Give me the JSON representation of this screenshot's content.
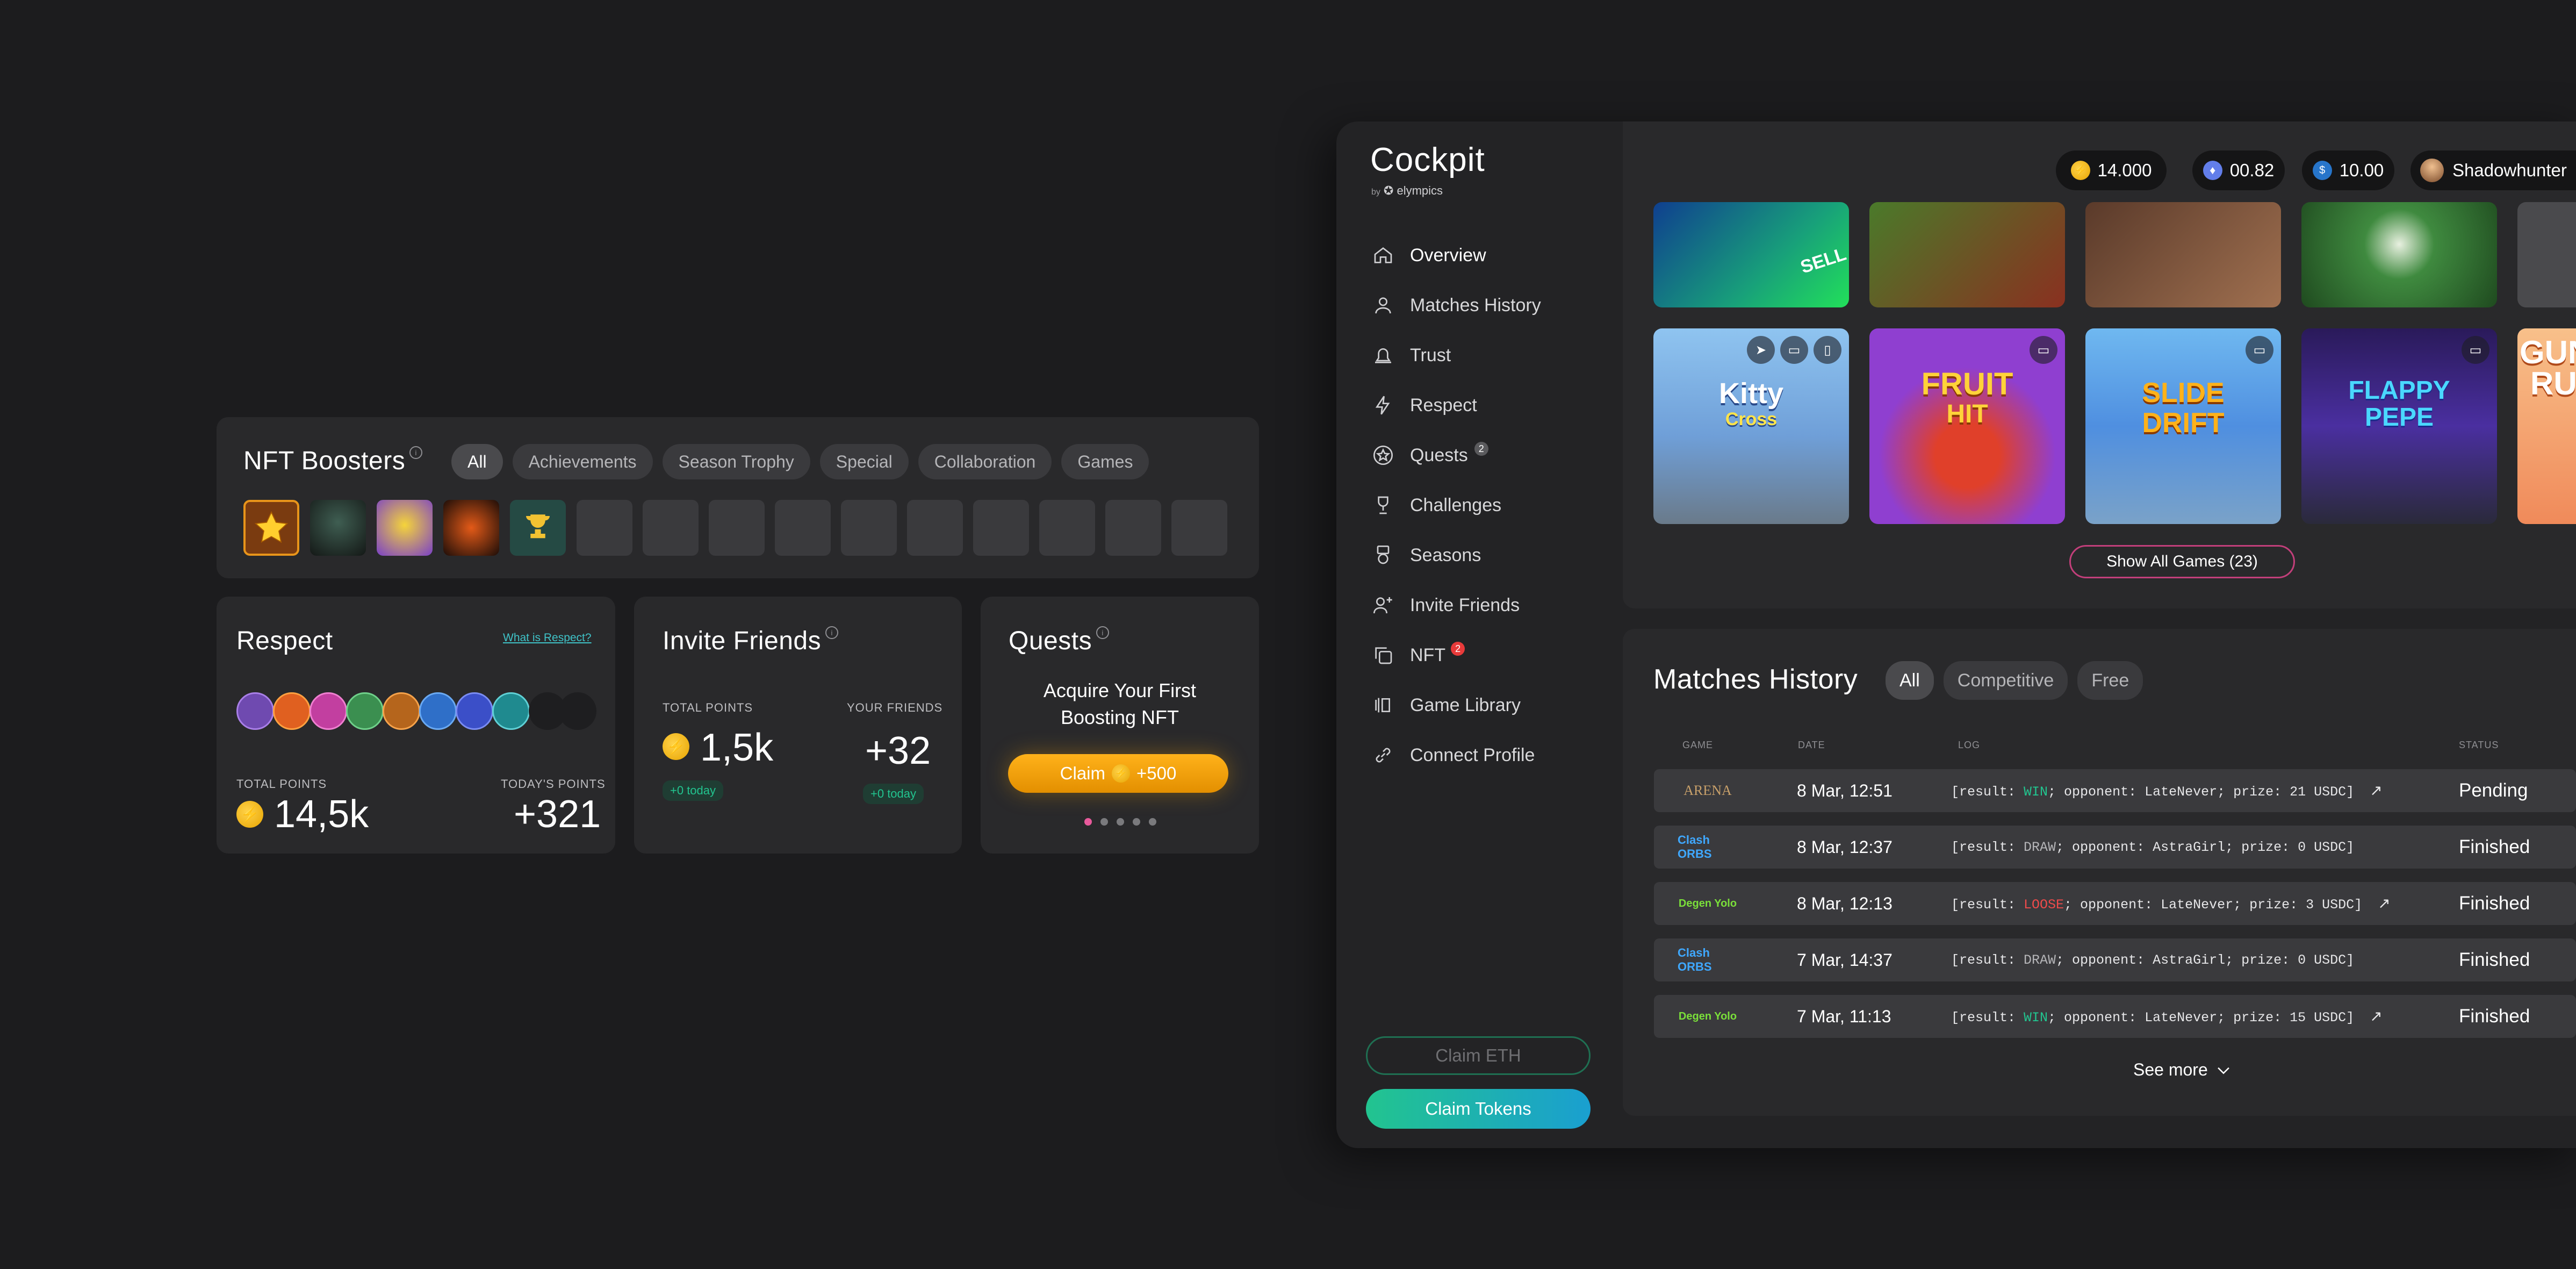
{
  "nft_boosters": {
    "title": "NFT Boosters",
    "filters": [
      "All",
      "Achievements",
      "Season Trophy",
      "Special",
      "Collaboration",
      "Games"
    ]
  },
  "respect": {
    "title": "Respect",
    "link": "What is Respect?",
    "total_label": "TOTAL POINTS",
    "total_value": "14,5k",
    "today_label": "TODAY'S POINTS",
    "today_value": "+321"
  },
  "invite": {
    "title": "Invite Friends",
    "total_label": "TOTAL POINTS",
    "total_value": "1,5k",
    "total_today": "+0 today",
    "friends_label": "YOUR FRIENDS",
    "friends_value": "+32",
    "friends_today": "+0 today"
  },
  "quests": {
    "title": "Quests",
    "text_line1": "Acquire Your First",
    "text_line2": "Boosting NFT",
    "claim_label": "Claim",
    "claim_amount": "+500"
  },
  "app": {
    "title": "Cockpit",
    "by": "by",
    "brand": "elympics"
  },
  "wallet": {
    "coins": "14.000",
    "eth": "00.82",
    "usdc": "10.00",
    "username": "Shadowhunter"
  },
  "nav": {
    "overview": "Overview",
    "matches": "Matches History",
    "trust": "Trust",
    "respect": "Respect",
    "quests": "Quests",
    "quests_badge": "2",
    "challenges": "Challenges",
    "seasons": "Seasons",
    "invite": "Invite Friends",
    "nft": "NFT",
    "nft_badge": "2",
    "library": "Game Library",
    "connect": "Connect Profile"
  },
  "games": {
    "tiles": [
      {
        "title_1": "Kitty",
        "title_2": "Cross",
        "bg": "#6f9fd8"
      },
      {
        "title_1": "FRUIT",
        "title_2": "HIT",
        "bg": "#8f3fd0"
      },
      {
        "title_1": "SLIDE",
        "title_2": "DRIFT",
        "bg": "#4f8fe0"
      },
      {
        "title_1": "FLAPPY",
        "title_2": "PEPE",
        "bg": "#4a2fa0"
      },
      {
        "title_1": "GUN",
        "title_2": "RU",
        "bg": "#f08a5a"
      }
    ],
    "top_sell_text": "SELL",
    "show_all": "Show All Games (23)"
  },
  "matches": {
    "title": "Matches History",
    "filters": [
      "All",
      "Competitive",
      "Free"
    ],
    "columns": [
      "GAME",
      "DATE",
      "LOG",
      "STATUS"
    ],
    "rows": [
      {
        "game": "ARENA",
        "date": "8 Mar, 12:51",
        "log_pre": "[result: ",
        "result": "WIN",
        "log_post": "; opponent: LateNever; prize: 21 USDC]",
        "status": "Pending",
        "result_color": "#22c48f"
      },
      {
        "game": "Clash ORBS",
        "date": "8 Mar, 12:37",
        "log_pre": "[result: ",
        "result": "DRAW",
        "log_post": "; opponent: AstraGirl; prize: 0 USDC]",
        "status": "Finished",
        "result_color": "#b5b5b8"
      },
      {
        "game": "Degen Yolo",
        "date": "8 Mar, 12:13",
        "log_pre": "[result: ",
        "result": "LOOSE",
        "log_post": "; opponent: LateNever; prize: 3 USDC]",
        "status": "Finished",
        "result_color": "#ef4b4b"
      },
      {
        "game": "Clash ORBS",
        "date": "7 Mar, 14:37",
        "log_pre": "[result: ",
        "result": "DRAW",
        "log_post": "; opponent: AstraGirl; prize: 0 USDC]",
        "status": "Finished",
        "result_color": "#b5b5b8"
      },
      {
        "game": "Degen Yolo",
        "date": "7 Mar, 11:13",
        "log_pre": "[result: ",
        "result": "WIN",
        "log_post": "; opponent: LateNever; prize: 15 USDC]",
        "status": "Finished",
        "result_color": "#22c48f"
      }
    ],
    "see_more": "See more"
  },
  "claims": {
    "eth": "Claim ETH",
    "tokens": "Claim Tokens"
  },
  "colors": {
    "background": "#1c1c1e",
    "panel": "#29292b",
    "accent_orange": "#f5a300",
    "accent_green": "#22c48f",
    "accent_pink": "#e85a9c"
  }
}
